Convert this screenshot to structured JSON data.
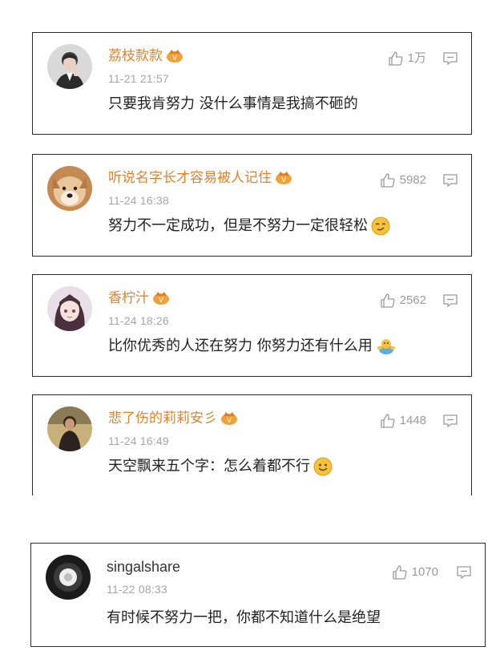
{
  "comments": [
    {
      "username": "荔枝款款",
      "time": "11-21 21:57",
      "likes": "1万",
      "text": "只要我肯努力 没什么事情是我搞不砸的",
      "vip": true,
      "emoji": "",
      "avatar": "man-portrait-icon"
    },
    {
      "username": "听说名字长才容易被人记住",
      "time": "11-24 16:38",
      "likes": "5982",
      "text": "努力不一定成功，但是不努力一定很轻松",
      "vip": true,
      "emoji": "smug-face-emoji",
      "avatar": "dog-icon"
    },
    {
      "username": "香柠汁",
      "time": "11-24 18:26",
      "likes": "2562",
      "text": "比你优秀的人还在努力 你努力还有什么用",
      "vip": true,
      "emoji": "hand-wave-emoji",
      "avatar": "anime-girl-icon"
    },
    {
      "username": "悲了伤的莉莉安彡",
      "time": "11-24 16:49",
      "likes": "1448",
      "text": "天空飘来五个字：怎么着都不行",
      "vip": true,
      "emoji": "smile-face-emoji",
      "avatar": "person-portrait-icon"
    },
    {
      "username": "singalshare",
      "time": "11-22 08:33",
      "likes": "1070",
      "text": "有时候不努力一把，你都不知道什么是绝望",
      "vip": false,
      "emoji": "",
      "avatar": "dark-circle-icon"
    }
  ],
  "colors": {
    "username": "#e0832d",
    "time": "#a6a6a6",
    "text": "#222222",
    "icon": "#9a9a9a",
    "vip_badge": "#f0a23a"
  }
}
